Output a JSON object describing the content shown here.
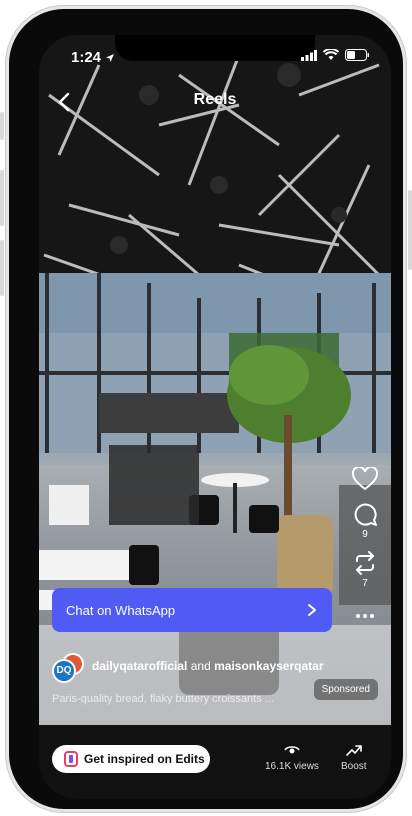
{
  "status_bar": {
    "time": "1:24"
  },
  "header": {
    "title": "Reels"
  },
  "rail": {
    "comments_count": "9",
    "reposts_count": "7"
  },
  "cta": {
    "label": "Chat on WhatsApp"
  },
  "author": {
    "avatar_initials": "DQ",
    "primary": "dailyqatarofficial",
    "joiner": "and",
    "secondary": "maisonkayserqatar",
    "sponsored_label": "Sponsored",
    "caption": "Paris-quality bread, flaky buttery croissants ..."
  },
  "bottom_bar": {
    "edits_label": "Get inspired on Edits",
    "views_label": "16.1K views",
    "boost_label": "Boost"
  },
  "colors": {
    "cta": "#4f5bf2",
    "bottom_bar": "#111111"
  },
  "icons": [
    "location-arrow-icon",
    "signal-icon",
    "wifi-icon",
    "battery-icon",
    "back-chevron-icon",
    "heart-icon",
    "comment-icon",
    "repost-icon",
    "more-icon",
    "chevron-right-icon",
    "edits-logo-icon",
    "views-icon",
    "boost-icon"
  ]
}
